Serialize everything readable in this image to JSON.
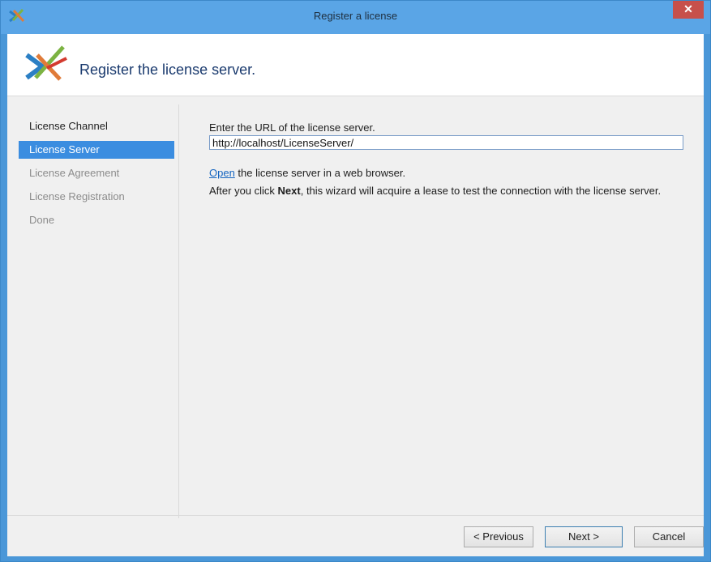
{
  "window": {
    "title": "Register a license",
    "close_glyph": "✕"
  },
  "header": {
    "title": "Register the license server."
  },
  "nav": {
    "items": [
      {
        "label": "License Channel",
        "state": "normal"
      },
      {
        "label": "License Server",
        "state": "active"
      },
      {
        "label": "License Agreement",
        "state": "disabled"
      },
      {
        "label": "License Registration",
        "state": "disabled"
      },
      {
        "label": "Done",
        "state": "disabled"
      }
    ]
  },
  "content": {
    "url_label": "Enter the URL of the license server.",
    "url_value": "http://localhost/LicenseServer/",
    "open_link": "Open",
    "open_rest": " the license server in a web browser.",
    "after_prefix": "After you click ",
    "after_bold": "Next",
    "after_rest": ", this wizard will acquire a lease to test the connection with the license server."
  },
  "footer": {
    "previous": "< Previous",
    "next": "Next >",
    "cancel": "Cancel"
  },
  "colors": {
    "accent": "#3b8de0",
    "titlebar": "#5aa5e6",
    "close": "#c7504b",
    "link": "#1565c0"
  }
}
